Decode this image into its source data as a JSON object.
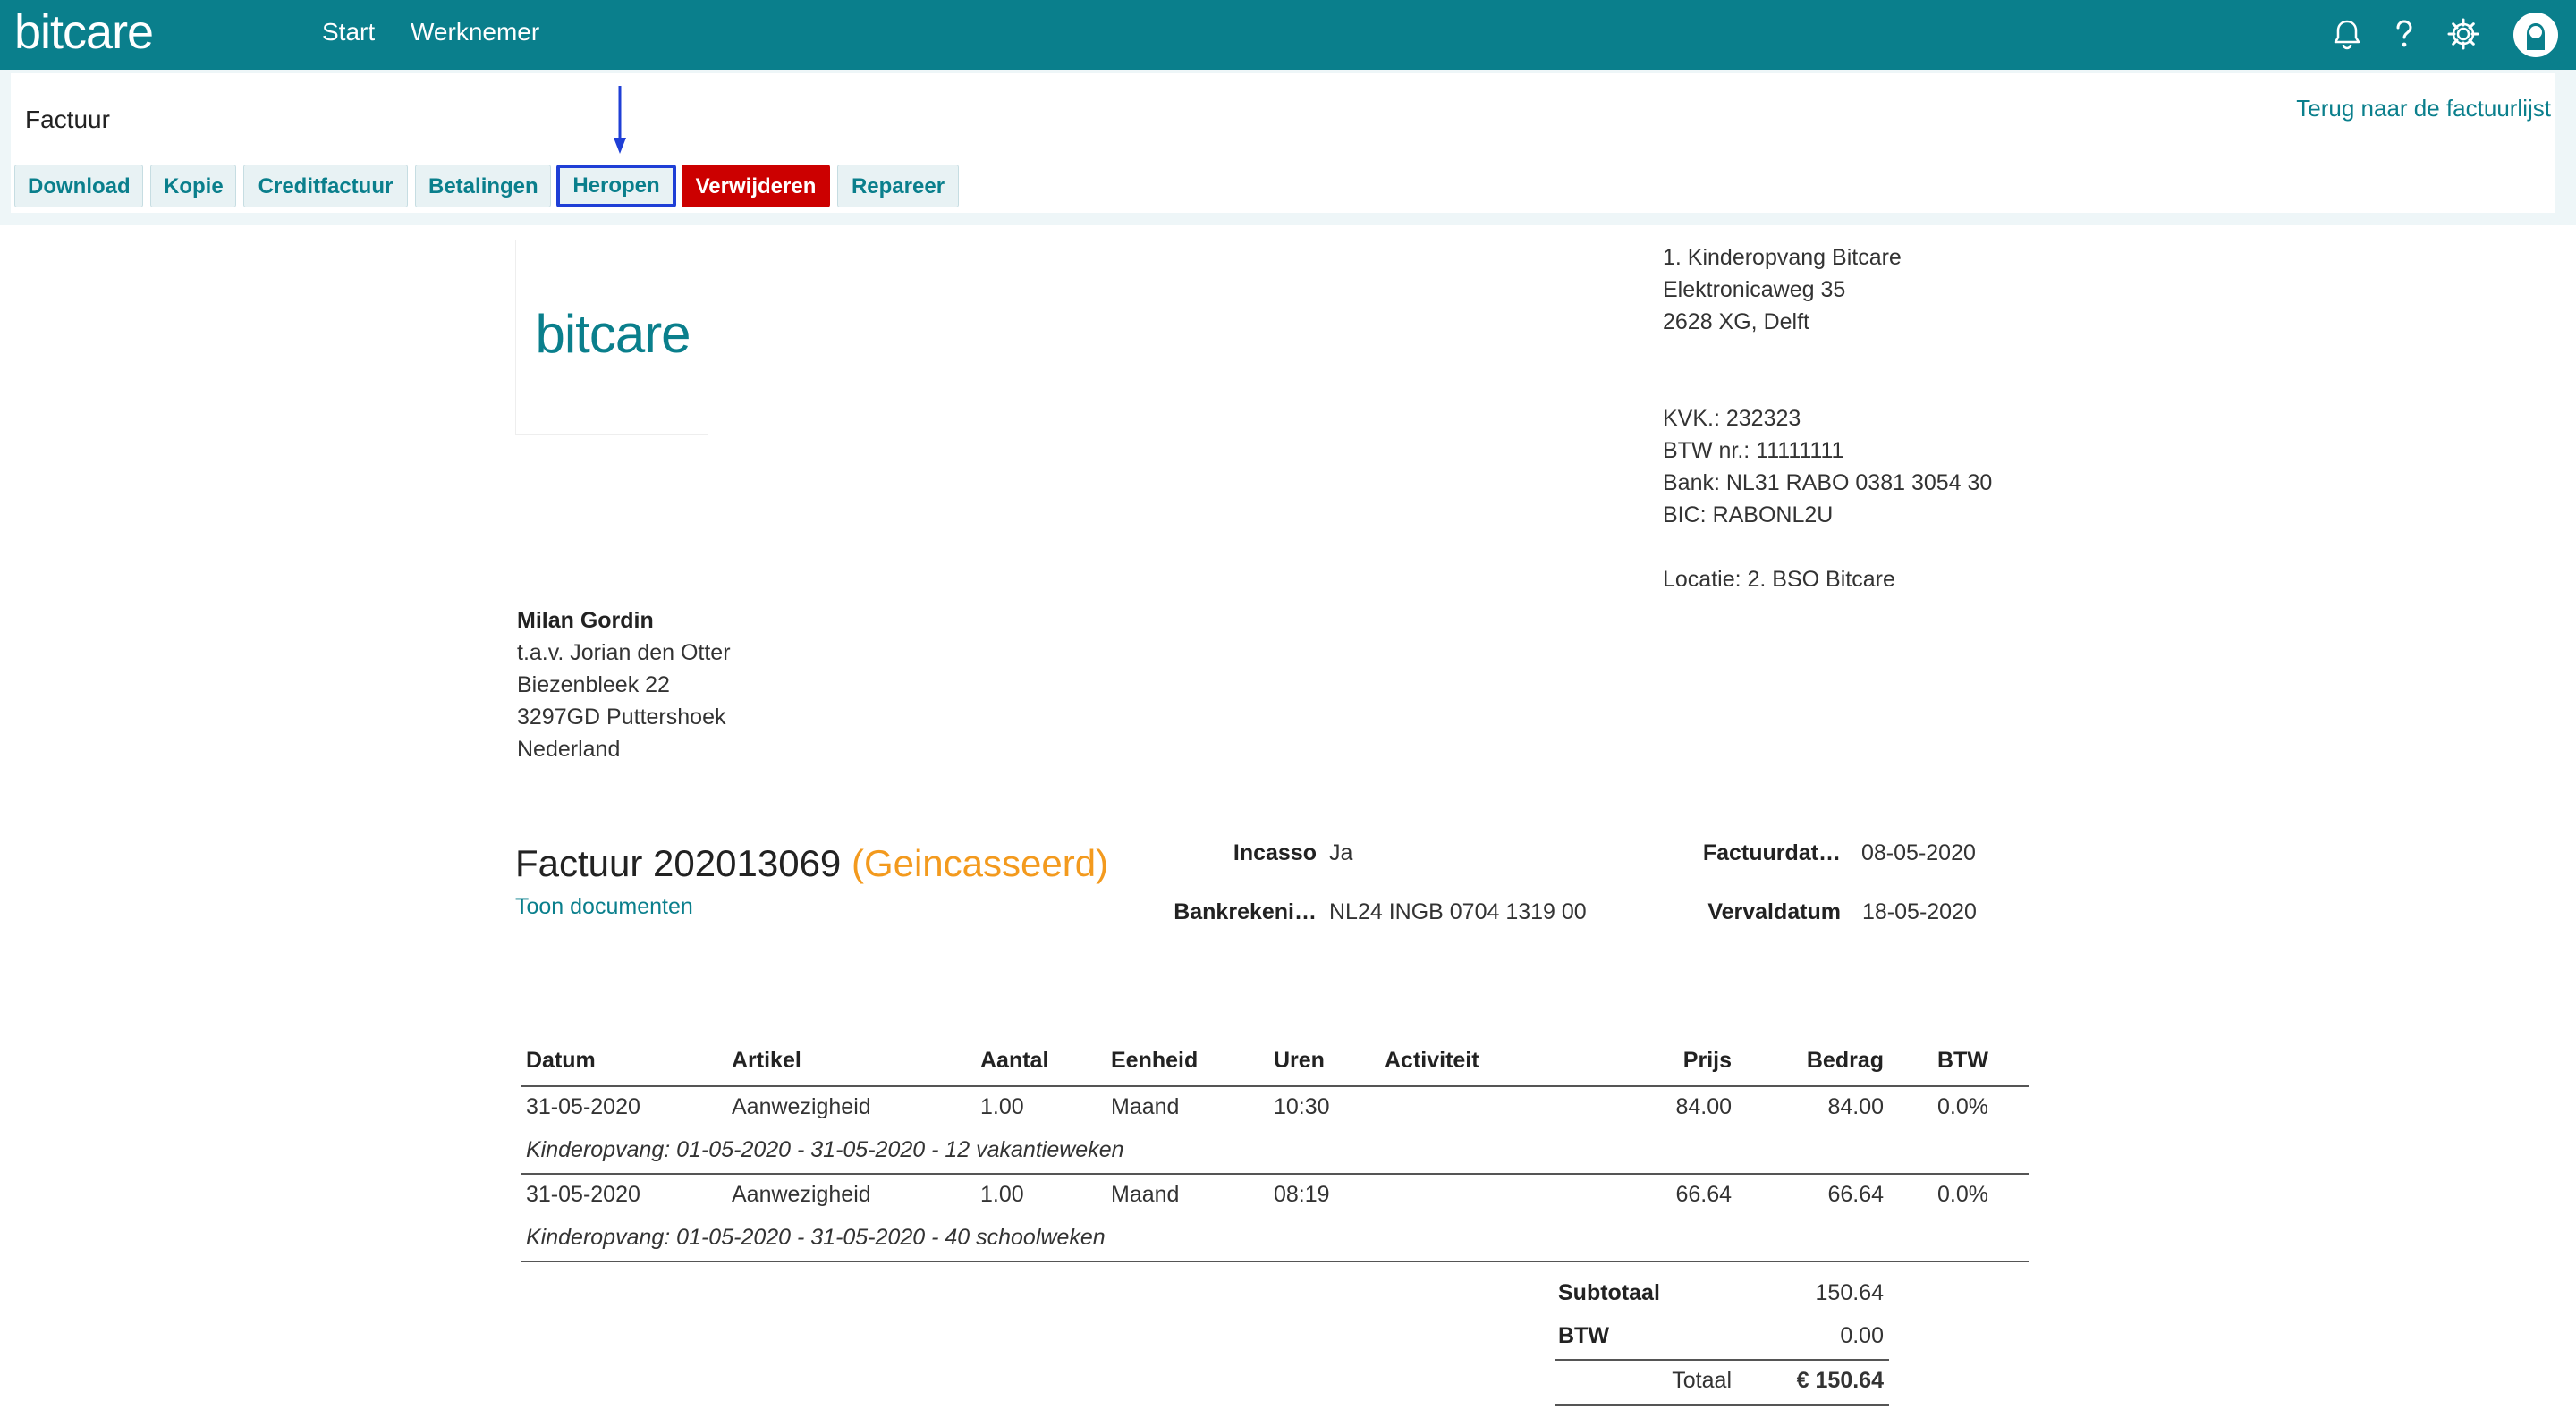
{
  "nav": {
    "brand": "bitcare",
    "items": [
      "Start",
      "Werknemer"
    ]
  },
  "header": {
    "title": "Factuur",
    "back_link": "Terug naar de factuurlijst",
    "buttons": [
      "Download",
      "Kopie",
      "Creditfactuur",
      "Betalingen",
      "Heropen",
      "Verwijderen",
      "Repareer"
    ]
  },
  "icons": [
    "bell-icon",
    "help-icon",
    "gear-icon",
    "user-avatar-icon",
    "arrow-down-icon"
  ],
  "colors": {
    "brand": "#0a7f8c",
    "danger": "#cc0000",
    "status": "#f39a1e",
    "highlight": "#1f3fd6"
  },
  "company": {
    "logo": "bitcare",
    "lines": [
      "1. Kinderopvang Bitcare",
      "Elektronicaweg 35",
      "2628 XG, Delft",
      "KVK.: 232323",
      "BTW nr.: 11111111",
      "Bank: NL31 RABO 0381 3054 30",
      "BIC: RABONL2U",
      "Locatie: 2. BSO Bitcare"
    ]
  },
  "recipient": {
    "name": "Milan Gordin",
    "lines": [
      "t.a.v. Jorian den Otter",
      "Biezenbleek 22",
      "3297GD Puttershoek",
      "Nederland"
    ]
  },
  "invoice": {
    "title": "Factuur 202013069",
    "status": "(Geincasseerd)",
    "documents_link": "Toon documenten",
    "incasso_label": "Incasso",
    "incasso_value": "Ja",
    "bank_label": "Bankrekeni…",
    "bank_value": "NL24 INGB 0704 1319 00",
    "date_label": "Factuurdat…",
    "date_value": "08-05-2020",
    "due_label": "Vervaldatum",
    "due_value": "18-05-2020"
  },
  "table": {
    "headers": [
      "Datum",
      "Artikel",
      "Aantal",
      "Eenheid",
      "Uren",
      "Activiteit",
      "Prijs",
      "Bedrag",
      "BTW"
    ],
    "rows": [
      {
        "datum": "31-05-2020",
        "artikel": "Aanwezigheid",
        "aantal": "1.00",
        "eenheid": "Maand",
        "uren": "10:30",
        "activiteit": "",
        "prijs": "84.00",
        "bedrag": "84.00",
        "btw": "0.0%",
        "desc": "Kinderopvang: 01-05-2020 - 31-05-2020 - 12 vakantieweken"
      },
      {
        "datum": "31-05-2020",
        "artikel": "Aanwezigheid",
        "aantal": "1.00",
        "eenheid": "Maand",
        "uren": "08:19",
        "activiteit": "",
        "prijs": "66.64",
        "bedrag": "66.64",
        "btw": "0.0%",
        "desc": "Kinderopvang: 01-05-2020 - 31-05-2020 - 40 schoolweken"
      }
    ]
  },
  "totals": {
    "subtotal_label": "Subtotaal",
    "subtotal_value": "150.64",
    "btw_label": "BTW",
    "btw_value": "0.00",
    "total_label": "Totaal",
    "total_value": "€ 150.64"
  }
}
